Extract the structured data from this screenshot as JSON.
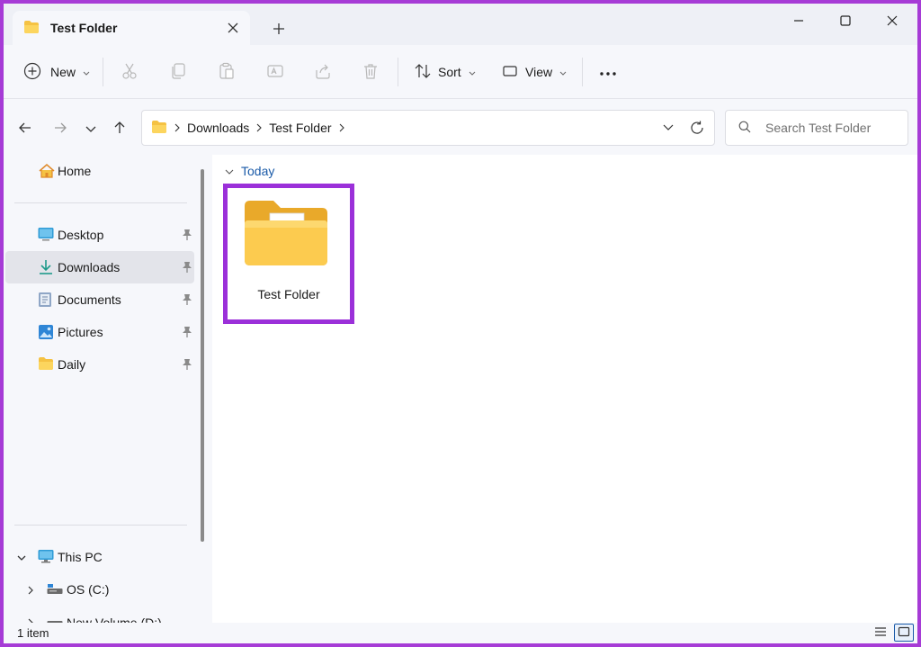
{
  "tab": {
    "title": "Test Folder",
    "close_icon": "close-icon",
    "add_icon": "plus-icon"
  },
  "window_controls": {
    "minimize": "minimize-icon",
    "maximize": "maximize-icon",
    "close": "close-icon"
  },
  "toolbar": {
    "new_label": "New",
    "sort_label": "Sort",
    "view_label": "View",
    "icons": [
      "cut-icon",
      "copy-icon",
      "paste-icon",
      "rename-icon",
      "share-icon",
      "delete-icon",
      "more-icon"
    ]
  },
  "breadcrumb": [
    "Downloads",
    "Test Folder"
  ],
  "search": {
    "placeholder": "Search Test Folder"
  },
  "sidebar": {
    "home": "Home",
    "quick_access": [
      {
        "label": "Desktop",
        "icon": "desktop-icon",
        "pinned": true,
        "selected": false
      },
      {
        "label": "Downloads",
        "icon": "download-icon",
        "pinned": true,
        "selected": true
      },
      {
        "label": "Documents",
        "icon": "documents-icon",
        "pinned": true,
        "selected": false
      },
      {
        "label": "Pictures",
        "icon": "pictures-icon",
        "pinned": true,
        "selected": false
      },
      {
        "label": "Daily",
        "icon": "folder-icon",
        "pinned": true,
        "selected": false
      }
    ],
    "this_pc": "This PC",
    "drives": [
      "OS (C:)",
      "New Volume (D:)"
    ]
  },
  "content": {
    "group_label": "Today",
    "items": [
      {
        "name": "Test Folder",
        "icon": "folder-icon",
        "highlight_color": "#9b30d9"
      }
    ]
  },
  "status": {
    "count": "1 item"
  },
  "colors": {
    "accent": "#1a5aa8",
    "frame": "#a63bd6",
    "highlight": "#9b30d9",
    "folder": "#f5c243"
  }
}
